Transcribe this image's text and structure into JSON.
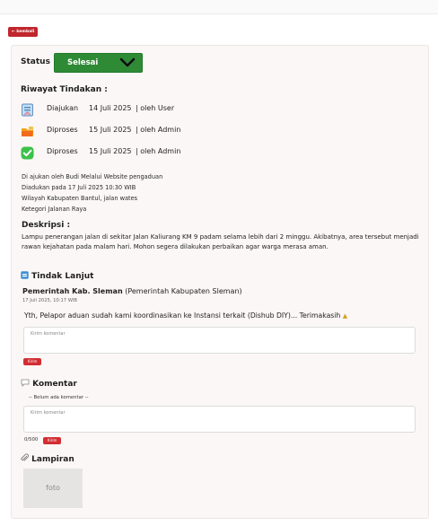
{
  "nav": {
    "back_label": "kembali"
  },
  "status": {
    "label": "Status",
    "value": "Selesai"
  },
  "riwayat": {
    "title": "Riwayat Tindakan :",
    "items": [
      {
        "status": "Diajukan",
        "date": "14 Juli 2025",
        "by": "| oleh User",
        "icon": "document-icon"
      },
      {
        "status": "Diproses",
        "date": "15 Juli 2025",
        "by": "| oleh  Admin",
        "icon": "folder-icon"
      },
      {
        "status": "Diproses",
        "date": "15 Juli 2025",
        "by": "| oleh  Admin",
        "icon": "check-icon"
      }
    ]
  },
  "info": {
    "line1": "Di ajukan oleh  Budi  Melalui Website pengaduan",
    "line2": "Diadukan pada 17 Juli 2025 10:30 WIB",
    "line3": "Wilayah Kabupaten Bantul, jalan wates",
    "line4": "Ketegori Jalanan Raya"
  },
  "deskripsi": {
    "title": "Deskripsi :",
    "body": "Lampu penerangan jalan di sekitar Jalan Kaliurang KM 9 padam selama lebih dari 2 minggu. Akibatnya, area tersebut menjadi rawan kejahatan pada malam hari. Mohon segera dilakukan perbaikan agar warga merasa aman."
  },
  "tindak_lanjut": {
    "title": "Tindak Lanjut",
    "org_name": "Pemerintah Kab. Sleman",
    "org_full": "(Pemerintah Kabupaten Sleman)",
    "date": "17 Juli 2025, 10:17 WIB",
    "message": "Yth, Pelapor aduan sudah kami koordinasikan ke Instansi terkait (Dishub DIY)... Terimakasih",
    "input_placeholder": "Kirim komentar",
    "send_label": "Kirim"
  },
  "komentar": {
    "title": "Komentar",
    "empty_text": "-- Belum ada komentar --",
    "input_placeholder": "Kirim komentar",
    "counter": "0/500",
    "send_label": "Kirim"
  },
  "lampiran": {
    "title": "Lampiran",
    "photo_label": "foto"
  },
  "colors": {
    "accent_red": "#d22d33",
    "status_green": "#2f8a36",
    "card_bg": "#fbf7f6"
  }
}
